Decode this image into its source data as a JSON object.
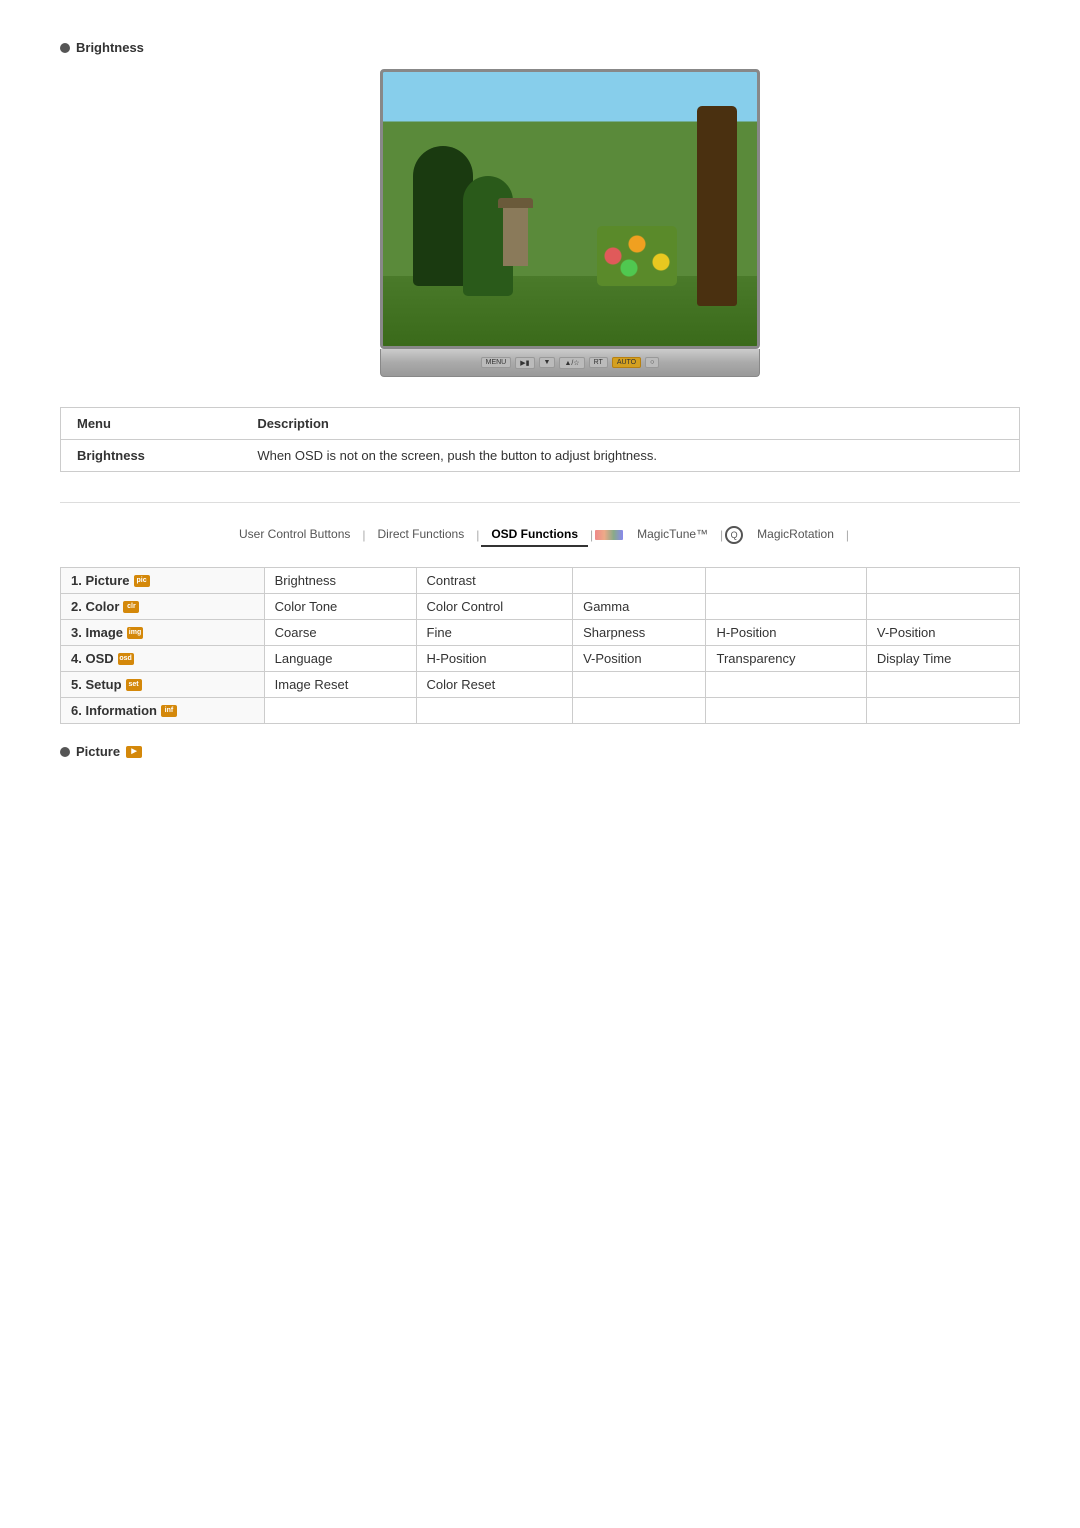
{
  "brightness_title": "Brightness",
  "picture_title": "Picture",
  "monitor_buttons": [
    "MENU",
    "▶▮",
    "▼",
    "▲/☆",
    "RT",
    "AUTO",
    "○"
  ],
  "menu_table": {
    "col1": "Menu",
    "col2": "Description",
    "row_label": "Brightness",
    "row_desc": "When OSD is not on the screen, push the button to adjust brightness."
  },
  "nav": {
    "tabs": [
      {
        "label": "User Control Buttons",
        "active": false
      },
      {
        "label": "Direct Functions",
        "active": false
      },
      {
        "label": "OSD Functions",
        "active": true
      },
      {
        "label": "MagicTune™",
        "active": false
      },
      {
        "label": "MagicRotation",
        "active": false
      }
    ]
  },
  "osd_table": {
    "rows": [
      {
        "id": "1",
        "label": "Picture",
        "icon": "pic",
        "cells": [
          "Brightness",
          "Contrast",
          "",
          "",
          ""
        ]
      },
      {
        "id": "2",
        "label": "Color",
        "icon": "clr",
        "cells": [
          "Color Tone",
          "Color Control",
          "Gamma",
          "",
          ""
        ]
      },
      {
        "id": "3",
        "label": "Image",
        "icon": "img",
        "cells": [
          "Coarse",
          "Fine",
          "Sharpness",
          "H-Position",
          "V-Position"
        ]
      },
      {
        "id": "4",
        "label": "OSD",
        "icon": "osd",
        "cells": [
          "Language",
          "H-Position",
          "V-Position",
          "Transparency",
          "Display Time"
        ]
      },
      {
        "id": "5",
        "label": "Setup",
        "icon": "set",
        "cells": [
          "Image Reset",
          "Color Reset",
          "",
          "",
          ""
        ]
      },
      {
        "id": "6",
        "label": "Information",
        "icon": "inf",
        "cells": [
          "",
          "",
          "",
          "",
          ""
        ]
      }
    ]
  }
}
